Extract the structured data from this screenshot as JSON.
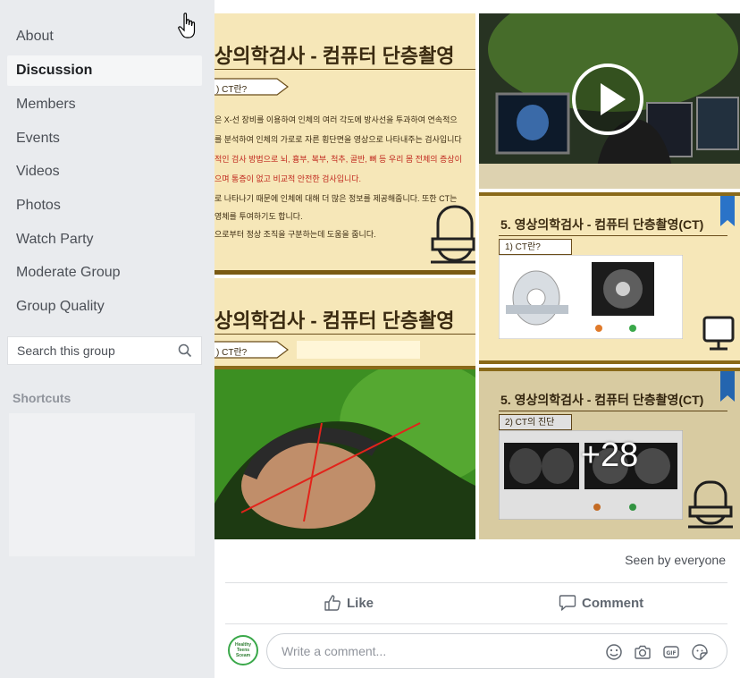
{
  "sidebar": {
    "items": [
      {
        "label": "About"
      },
      {
        "label": "Discussion",
        "active": true
      },
      {
        "label": "Members"
      },
      {
        "label": "Events"
      },
      {
        "label": "Videos"
      },
      {
        "label": "Photos"
      },
      {
        "label": "Watch Party"
      },
      {
        "label": "Moderate Group"
      },
      {
        "label": "Group Quality"
      }
    ],
    "search_placeholder": "Search this group",
    "shortcuts_label": "Shortcuts"
  },
  "post": {
    "photos": {
      "tile1": {
        "title": "상의학검사 - 컴퓨터 단층촬영",
        "pill": ") CT란?",
        "lines": [
          "은 X-선 장비를 이용하여 인체의 여러 각도에 방사선을 투과하여 연속적으",
          "를 분석하여 인체의 가로로 자른 횡단면을 영상으로 나타내주는 검사입니다",
          "적인 검사 방법으로 뇌, 흉부, 복부, 척추, 골반, 뼈 등 우리 몸 전체의 증상이",
          "으며 통증이 없고 비교적 안전한 검사입니다.",
          "로 나타나기 때문에 인체에 대해 더 많은 정보를 제공해줍니다. 또한 CT는",
          "영체를 투여하기도 합니다.",
          "으로부터 정상 조직을 구분하는데 도움을 줍니다."
        ]
      },
      "tile2": {
        "title": "상의학검사 - 컴퓨터 단층촬영",
        "pill": ") CT란?"
      },
      "tile4": {
        "title": "5. 영상의학검사 - 컴퓨터 단층촬영(CT)",
        "pill": "1) CT란?"
      },
      "tile5": {
        "title": "5. 영상의학검사 - 컴퓨터 단층촬영(CT)",
        "pill": "2) CT의 진단"
      },
      "more_count": "+28"
    },
    "seen_by": "Seen by everyone",
    "like_label": "Like",
    "comment_label": "Comment",
    "avatar_text": "Healthy Teens Sceam",
    "comment_placeholder": "Write a comment..."
  },
  "colors": {
    "accent_green": "#3aa84a",
    "slide_bg": "#f6e7b8",
    "slide_border": "#8a6a1a"
  },
  "icons": [
    "hand-cursor-icon",
    "search-icon",
    "play-icon",
    "like-icon",
    "comment-icon",
    "emoji-icon",
    "camera-icon",
    "gif-icon",
    "sticker-icon"
  ]
}
